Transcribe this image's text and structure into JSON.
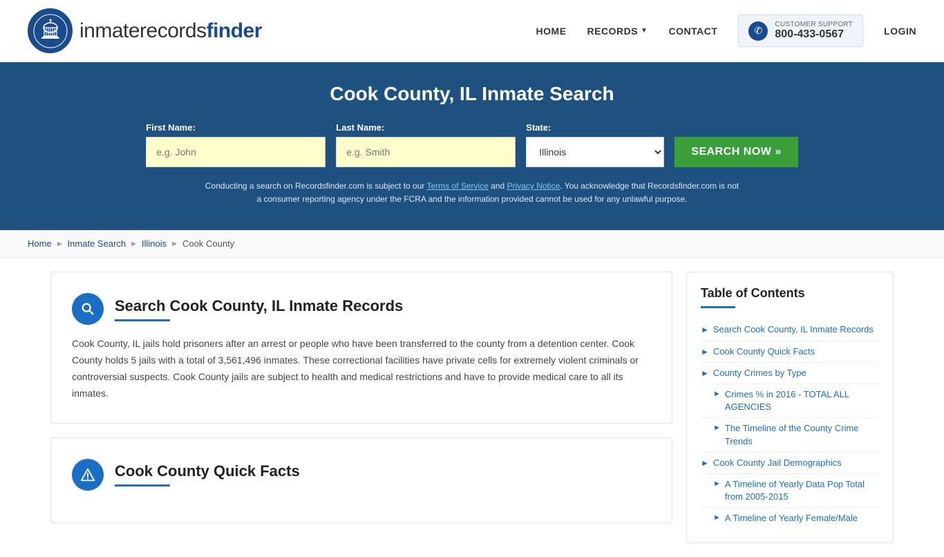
{
  "header": {
    "logo_text_normal": "inmaterecords",
    "logo_text_bold": "finder",
    "nav": {
      "home": "HOME",
      "records": "RECORDS",
      "contact": "CONTACT",
      "login": "LOGIN"
    },
    "support": {
      "label": "CUSTOMER SUPPORT",
      "number": "800-433-0567"
    }
  },
  "hero": {
    "title": "Cook County, IL Inmate Search",
    "form": {
      "first_name_label": "First Name:",
      "first_name_placeholder": "e.g. John",
      "last_name_label": "Last Name:",
      "last_name_placeholder": "e.g. Smith",
      "state_label": "State:",
      "state_value": "Illinois",
      "search_button": "SEARCH NOW »"
    },
    "disclaimer": "Conducting a search on Recordsfinder.com is subject to our Terms of Service and Privacy Notice. You acknowledge that Recordsfinder.com is not a consumer reporting agency under the FCRA and the information provided cannot be used for any unlawful purpose.",
    "terms_link": "Terms of Service",
    "privacy_link": "Privacy Notice"
  },
  "breadcrumb": {
    "items": [
      "Home",
      "Inmate Search",
      "Illinois",
      "Cook County"
    ]
  },
  "main": {
    "section1": {
      "title": "Search Cook County, IL Inmate Records",
      "body": "Cook County, IL jails hold prisoners after an arrest or people who have been transferred to the county from a detention center. Cook County holds 5 jails with a total of 3,561,496 inmates. These correctional facilities have private cells for extremely violent criminals or controversial suspects. Cook County jails are subject to health and medical restrictions and have to provide medical care to all its inmates."
    },
    "section2": {
      "title": "Cook County Quick Facts"
    }
  },
  "toc": {
    "title": "Table of Contents",
    "items": [
      {
        "label": "Search Cook County, IL Inmate Records",
        "sub": false
      },
      {
        "label": "Cook County Quick Facts",
        "sub": false
      },
      {
        "label": "County Crimes by Type",
        "sub": false
      },
      {
        "label": "Crimes % in 2016 - TOTAL ALL AGENCIES",
        "sub": true
      },
      {
        "label": "The Timeline of the County Crime Trends",
        "sub": true
      },
      {
        "label": "Cook County Jail Demographics",
        "sub": false
      },
      {
        "label": "A Timeline of Yearly Data Pop Total from 2005-2015",
        "sub": true
      },
      {
        "label": "A Timeline of Yearly Female/Male",
        "sub": true
      }
    ]
  }
}
